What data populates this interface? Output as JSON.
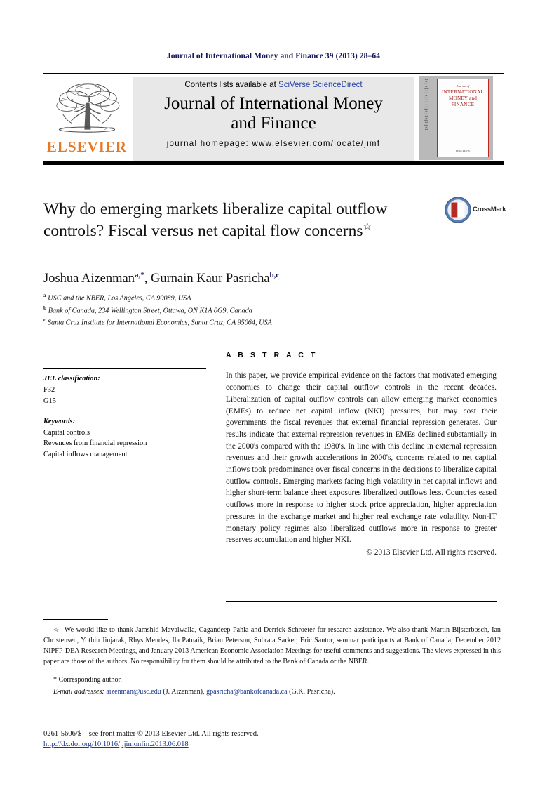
{
  "running_head": "Journal of International Money and Finance 39 (2013) 28–64",
  "masthead": {
    "contents_prefix": "Contents lists available at ",
    "sciencedirect": "SciVerse ScienceDirect",
    "journal_title_line1": "Journal of International Money",
    "journal_title_line2": "and Finance",
    "homepage": "journal homepage: www.elsevier.com/locate/jimf",
    "publisher_wordmark": "ELSEVIER",
    "publisher_color": "#e87722",
    "sciencedirect_color": "#2b44a8"
  },
  "cover": {
    "journal_word": "Journal of",
    "title": "INTERNATIONAL MONEY and FINANCE",
    "publisher": "PERGAMON",
    "border_color": "#c0241f"
  },
  "article": {
    "title": "Why do emerging markets liberalize capital outflow controls? Fiscal versus net capital flow concerns",
    "title_footnote_marker": "☆",
    "crossmark_label": "CrossMark",
    "authors": [
      {
        "name": "Joshua Aizenman",
        "marks": "a,*"
      },
      {
        "name": "Gurnain Kaur Pasricha",
        "marks": "b,c"
      }
    ],
    "affiliations": [
      {
        "mark": "a",
        "text": "USC and the NBER, Los Angeles, CA 90089, USA"
      },
      {
        "mark": "b",
        "text": "Bank of Canada, 234 Wellington Street, Ottawa, ON K1A 0G9, Canada"
      },
      {
        "mark": "c",
        "text": "Santa Cruz Institute for International Economics, Santa Cruz, CA 95064, USA"
      }
    ]
  },
  "meta": {
    "jel_heading": "JEL classification:",
    "jel_codes": [
      "F32",
      "G15"
    ],
    "keywords_heading": "Keywords:",
    "keywords": [
      "Capital controls",
      "Revenues from financial repression",
      "Capital inflows management"
    ]
  },
  "abstract": {
    "heading": "A B S T R A C T",
    "body": "In this paper, we provide empirical evidence on the factors that motivated emerging economies to change their capital outflow controls in the recent decades. Liberalization of capital outflow controls can allow emerging market economies (EMEs) to reduce net capital inflow (NKI) pressures, but may cost their governments the fiscal revenues that external financial repression generates. Our results indicate that external repression revenues in EMEs declined substantially in the 2000's compared with the 1980's. In line with this decline in external repression revenues and their growth accelerations in 2000's, concerns related to net capital inflows took predominance over fiscal concerns in the decisions to liberalize capital outflow controls. Emerging markets facing high volatility in net capital inflows and higher short-term balance sheet exposures liberalized outflows less. Countries eased outflows more in response to higher stock price appreciation, higher appreciation pressures in the exchange market and higher real exchange rate volatility. Non-IT monetary policy regimes also liberalized outflows more in response to greater reserves accumulation and higher NKI.",
    "copyright": "© 2013 Elsevier Ltd. All rights reserved."
  },
  "footnotes": {
    "acknowledgement_marker": "☆",
    "acknowledgement": "We would like to thank Jamshid Mavalwalla, Cagandeep Pahla and Derrick Schroeter for research assistance. We also thank Martin Bijsterbosch, Ian Christensen, Yothin Jinjarak, Rhys Mendes, Ila Patnaik, Brian Peterson, Subrata Sarker, Eric Santor, seminar participants at Bank of Canada, December 2012 NIPFP-DEA Research Meetings, and January 2013 American Economic Association Meetings for useful comments and suggestions. The views expressed in this paper are those of the authors. No responsibility for them should be attributed to the Bank of Canada or the NBER.",
    "corresponding_marker": "*",
    "corresponding": "Corresponding author.",
    "email_label": "E-mail addresses:",
    "emails": [
      {
        "address": "aizenman@usc.edu",
        "owner": "(J. Aizenman)"
      },
      {
        "address": "gpasricha@bankofcanada.ca",
        "owner": "(G.K. Pasricha)"
      }
    ],
    "link_color": "#1b3a8c"
  },
  "bottom": {
    "issn_line": "0261-5606/$ – see front matter © 2013 Elsevier Ltd. All rights reserved.",
    "doi": "http://dx.doi.org/10.1016/j.jimonfin.2013.06.018"
  }
}
